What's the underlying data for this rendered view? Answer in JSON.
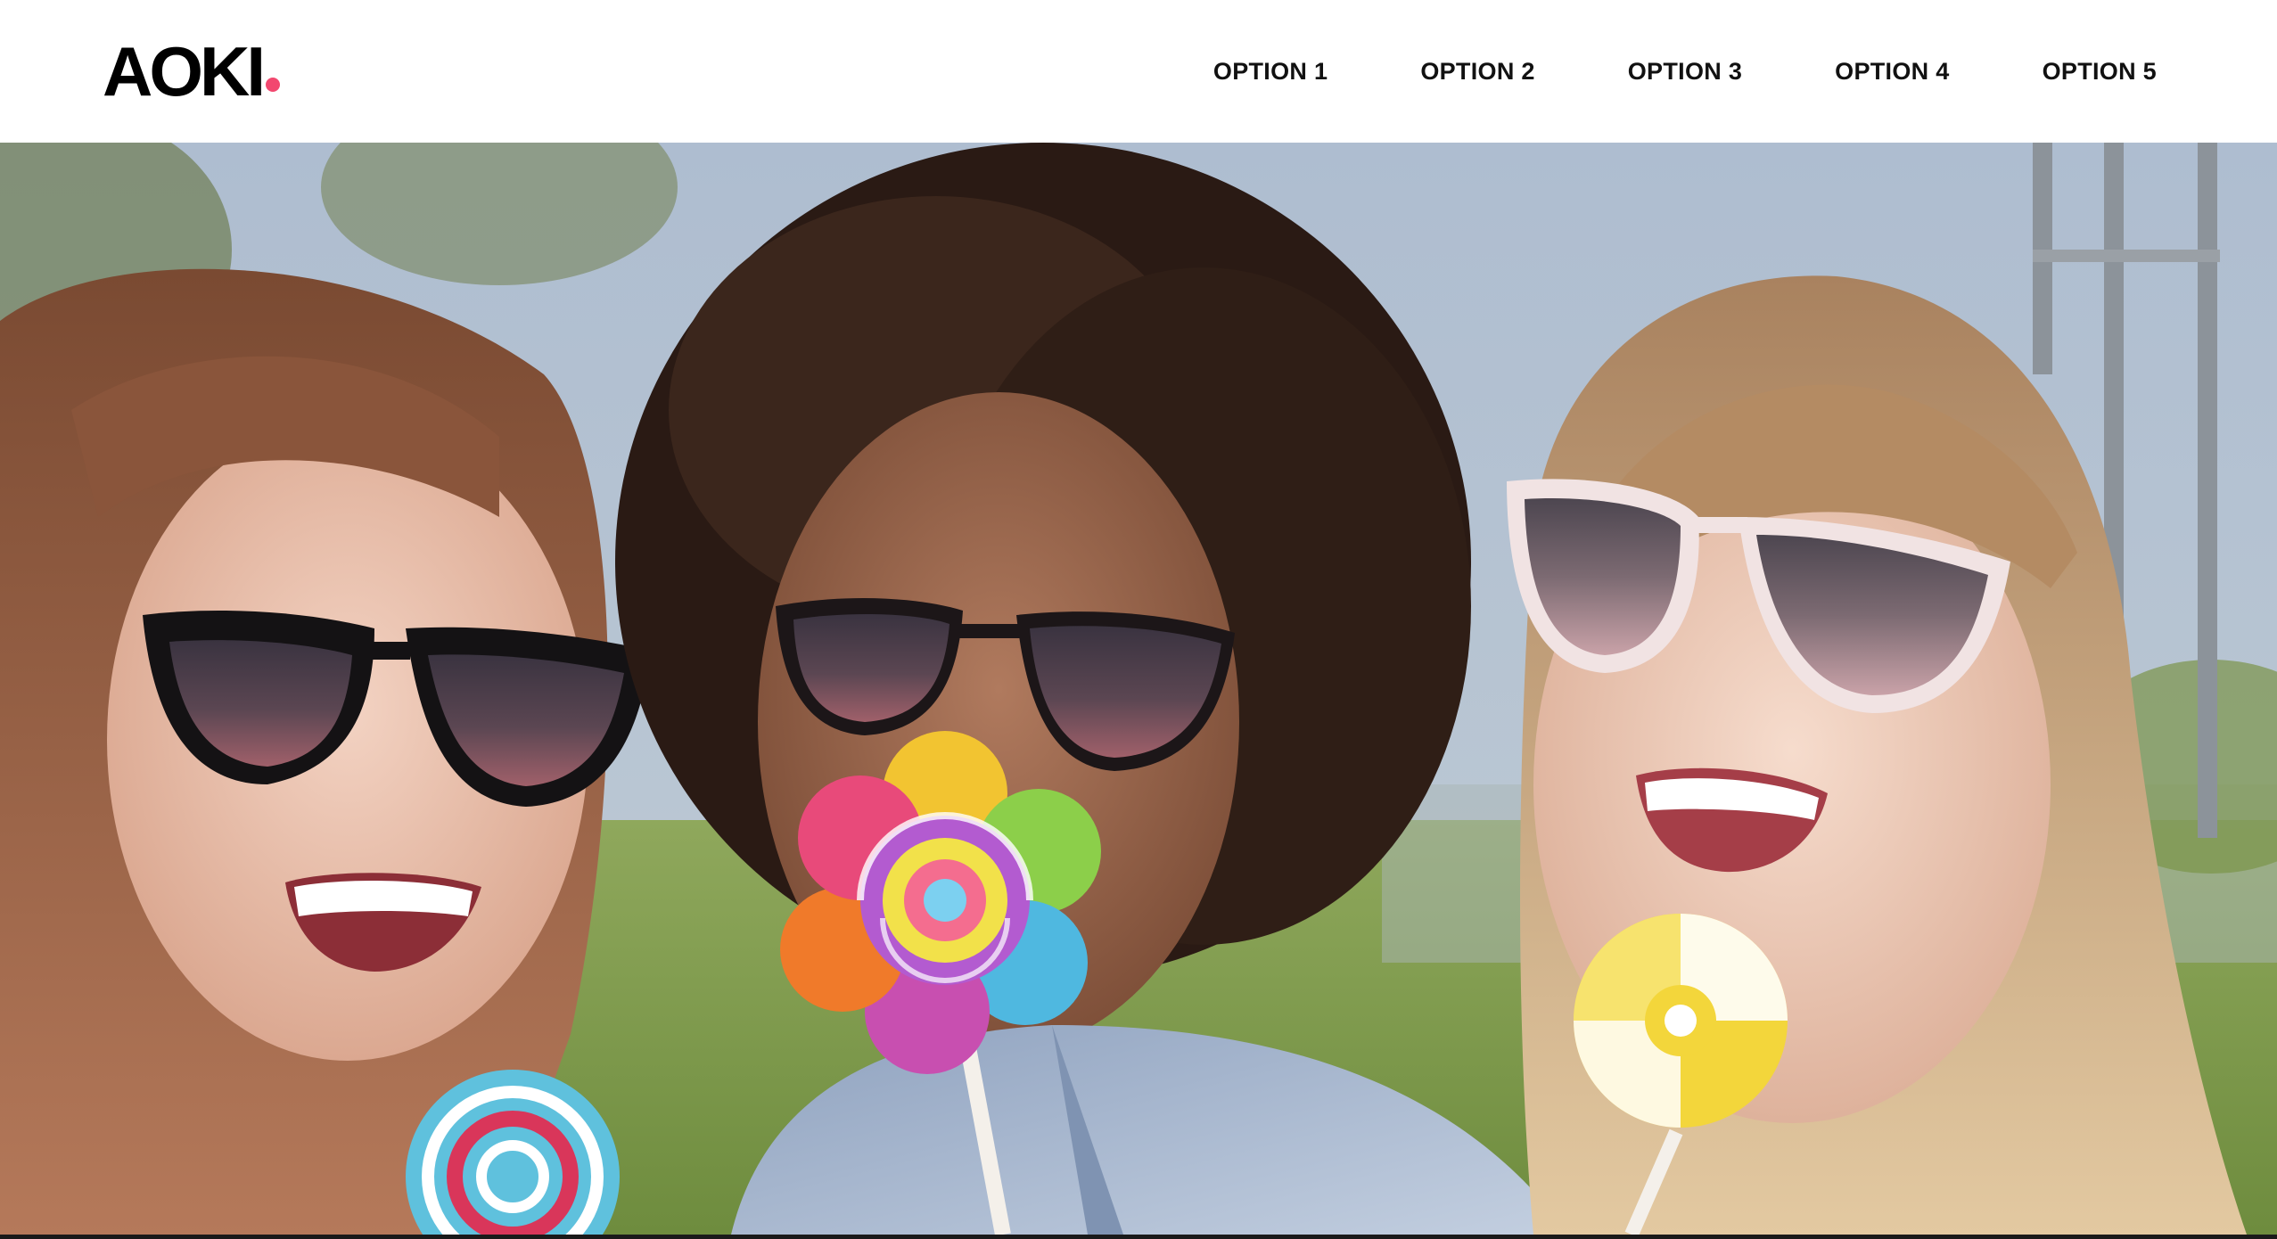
{
  "brand": {
    "name": "AOKI",
    "accent_color": "#f2486f"
  },
  "nav": {
    "items": [
      {
        "label": "OPTION 1"
      },
      {
        "label": "OPTION 2"
      },
      {
        "label": "OPTION 3"
      },
      {
        "label": "OPTION 4"
      },
      {
        "label": "OPTION 5"
      }
    ]
  },
  "hero": {
    "image_alt": "",
    "colors": {
      "sky": "#a9b7c8",
      "grass": "#7f9c4e"
    }
  }
}
